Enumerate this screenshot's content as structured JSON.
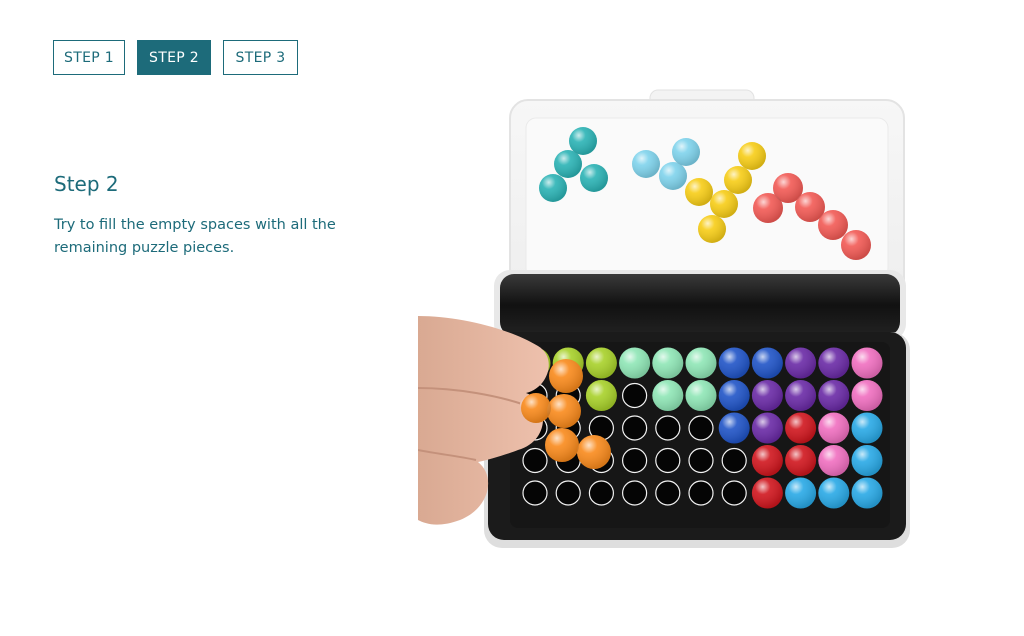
{
  "steps": {
    "tabs": [
      {
        "label": "STEP 1",
        "active": false
      },
      {
        "label": "STEP 2",
        "active": true
      },
      {
        "label": "STEP 3",
        "active": false
      }
    ]
  },
  "content": {
    "title": "Step 2",
    "description": "Try to fill the empty spaces with all the remaining puzzle pieces."
  },
  "colors": {
    "accent": "#1d6b7a",
    "background": "#ffffff"
  }
}
